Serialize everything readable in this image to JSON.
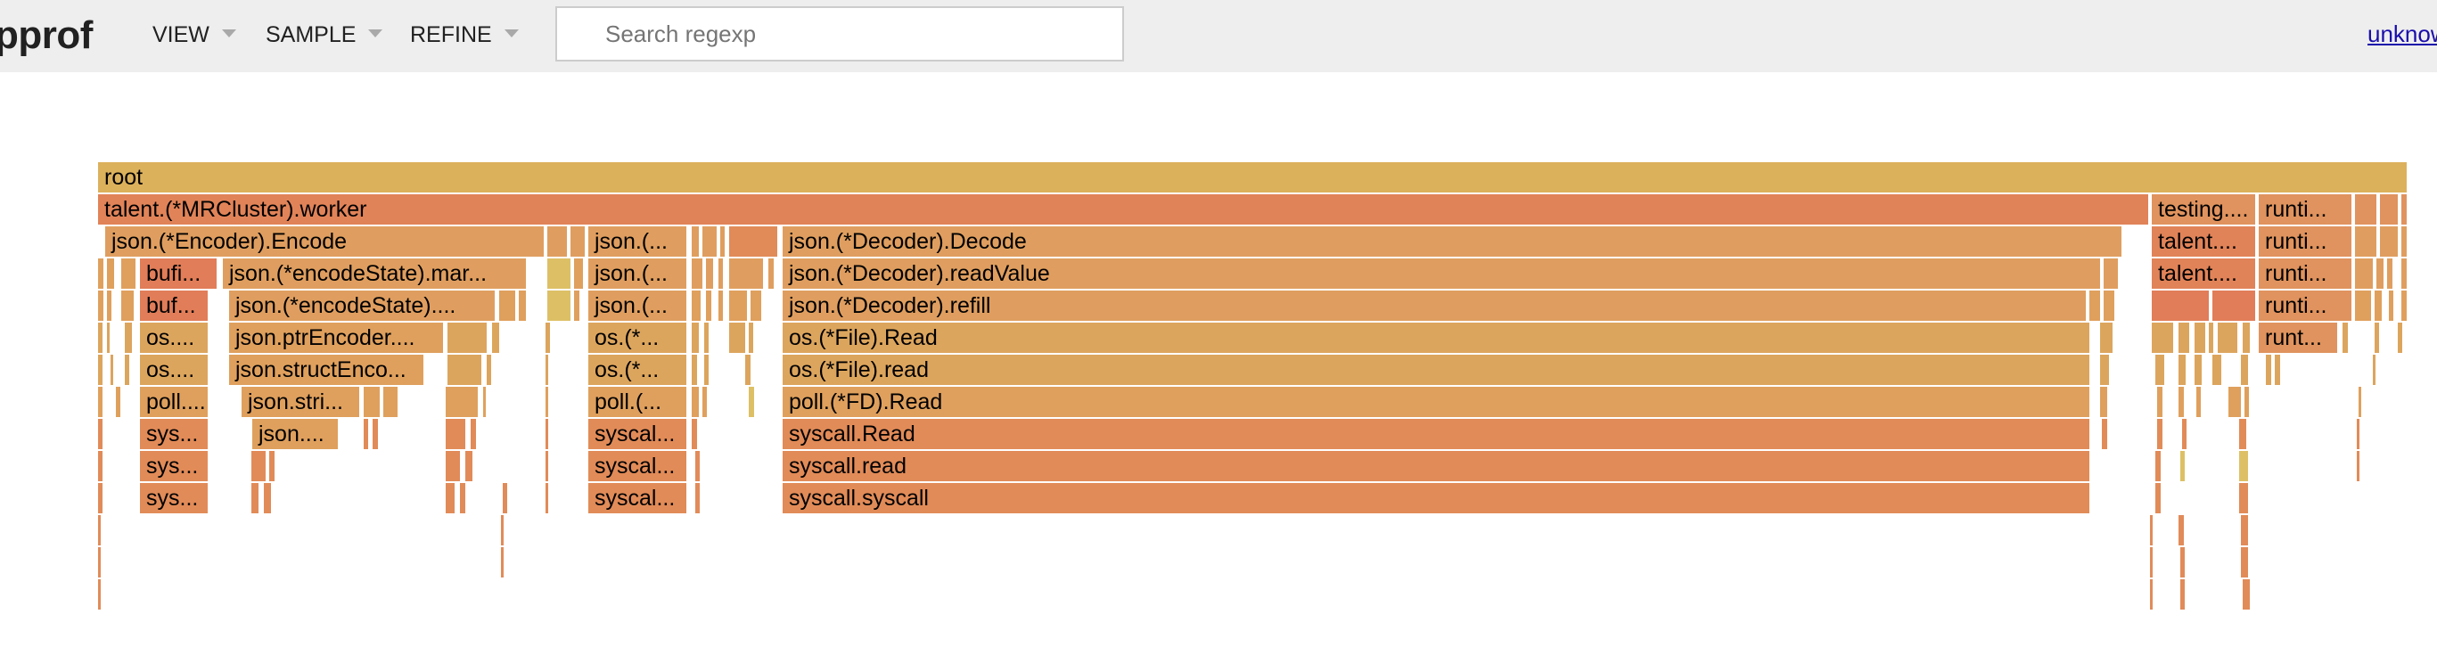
{
  "header": {
    "logo": "pprof",
    "menus": [
      {
        "label": "VIEW"
      },
      {
        "label": "SAMPLE"
      },
      {
        "label": "REFINE"
      }
    ],
    "search_placeholder": "Search regexp",
    "user_link": "unknown"
  },
  "flamegraph": {
    "frames": [
      {
        "label": "root",
        "color": "#dcb15c"
      },
      {
        "label": "talent.(*MRCluster).worker",
        "color": "#e18358"
      },
      {
        "label": "testing....",
        "color": "#e0935e"
      },
      {
        "label": "runti...",
        "color": "#e0935e"
      },
      {
        "label": "json.(*Encoder).Encode",
        "color": "#df9e5f"
      },
      {
        "label": "json.(...",
        "color": "#df9e5f"
      },
      {
        "label": "json.(*Decoder).Decode",
        "color": "#df9e5f"
      },
      {
        "label": "talent....",
        "color": "#e18358"
      },
      {
        "label": "runti...",
        "color": "#e0935e"
      },
      {
        "label": "bufi...",
        "color": "#e17d58"
      },
      {
        "label": "json.(*encodeState).mar...",
        "color": "#df9e5f"
      },
      {
        "label": "json.(...",
        "color": "#df9e5f"
      },
      {
        "label": "json.(*Decoder).readValue",
        "color": "#df9e5f"
      },
      {
        "label": "talent....",
        "color": "#e18358"
      },
      {
        "label": "runti...",
        "color": "#e0935e"
      },
      {
        "label": "buf...",
        "color": "#e17d58"
      },
      {
        "label": "json.(*encodeState)....",
        "color": "#df9e5f"
      },
      {
        "label": "json.(...",
        "color": "#df9e5f"
      },
      {
        "label": "json.(*Decoder).refill",
        "color": "#df9e5f"
      },
      {
        "label": "runti...",
        "color": "#e0935e"
      },
      {
        "label": "os....",
        "color": "#dca55d"
      },
      {
        "label": "json.ptrEncoder....",
        "color": "#dfa05d"
      },
      {
        "label": "os.(*...",
        "color": "#dca55d"
      },
      {
        "label": "os.(*File).Read",
        "color": "#dca55d"
      },
      {
        "label": "runt...",
        "color": "#e0935e"
      },
      {
        "label": "os....",
        "color": "#dca55d"
      },
      {
        "label": "json.structEnco...",
        "color": "#dfa05d"
      },
      {
        "label": "os.(*...",
        "color": "#dca55d"
      },
      {
        "label": "os.(*File).read",
        "color": "#dca55d"
      },
      {
        "label": "poll....",
        "color": "#dfa05d"
      },
      {
        "label": "json.stri...",
        "color": "#dfa05d"
      },
      {
        "label": "poll.(...",
        "color": "#dfa05d"
      },
      {
        "label": "poll.(*FD).Read",
        "color": "#dfa05d"
      },
      {
        "label": "sys...",
        "color": "#e18b58"
      },
      {
        "label": "json....",
        "color": "#dfa05d"
      },
      {
        "label": "syscal...",
        "color": "#e18b58"
      },
      {
        "label": "syscall.Read",
        "color": "#e18b58"
      },
      {
        "label": "sys...",
        "color": "#e18b58"
      },
      {
        "label": "syscal...",
        "color": "#e18b58"
      },
      {
        "label": "syscall.read",
        "color": "#e18b58"
      },
      {
        "label": "sys...",
        "color": "#e18b58"
      },
      {
        "label": "syscal...",
        "color": "#e18b58"
      },
      {
        "label": "syscall.syscall",
        "color": "#e18b58"
      }
    ],
    "slivers": [
      {
        "color": "#e0935e"
      },
      {
        "color": "#df9e5f"
      },
      {
        "color": "#dfa05d"
      },
      {
        "color": "#dca55d"
      },
      {
        "color": "#e18b58"
      },
      {
        "color": "#ddc066"
      },
      {
        "color": "#e17d58"
      }
    ]
  }
}
